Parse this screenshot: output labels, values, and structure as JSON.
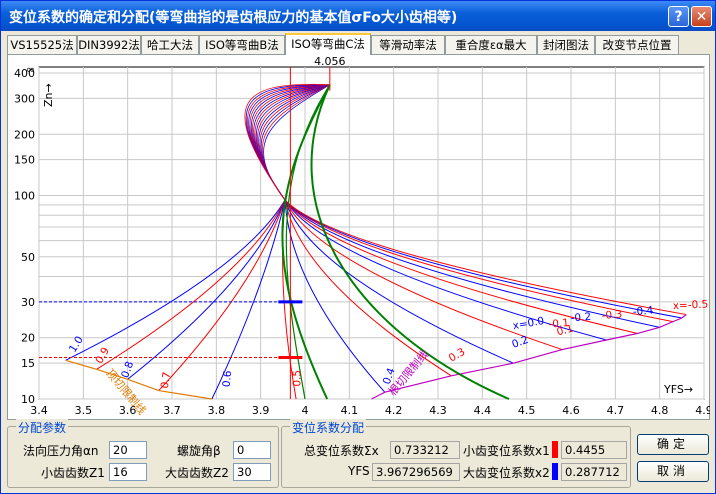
{
  "window": {
    "title": "变位系数的确定和分配(等弯曲指的是齿根应力的基本值σFo大小齿相等)",
    "help_label": "?",
    "close_label": "✕"
  },
  "tabs": [
    "VS15525法",
    "DIN3992法",
    "哈工大法",
    "ISO等弯曲B法",
    "ISO等弯曲C法",
    "等滑动率法",
    "重合度εα最大",
    "封闭图法",
    "改变节点位置"
  ],
  "active_tab": 4,
  "chart_data": {
    "type": "line",
    "xlabel": "YFS→",
    "ylabel": "Zn→",
    "xlim": [
      3.4,
      4.9
    ],
    "y_scale": "log",
    "ylim": [
      10,
      400
    ],
    "x_ticks": [
      "3.4",
      "3.5",
      "3.6",
      "3.7",
      "3.8",
      "3.9",
      "4",
      "4.1",
      "4.2",
      "4.3",
      "4.4",
      "4.5",
      "4.6",
      "4.7",
      "4.8",
      "4.9"
    ],
    "y_ticks": [
      "10",
      "15",
      "20",
      "30",
      "50",
      "100",
      "150",
      "200",
      "300",
      "400",
      "∞"
    ],
    "marker_value": "4.056",
    "marker_x": 4.056,
    "vertical_line_x": 3.967,
    "horizontal_lines": [
      {
        "y": 30,
        "color": "#0000ff",
        "x_end": 3.967
      },
      {
        "y": 16,
        "color": "#ff0000",
        "x_end": 3.967
      }
    ],
    "curve_labels": [
      {
        "text": "1.0",
        "color": "#0000ff"
      },
      {
        "text": "0.9",
        "color": "#ff0000"
      },
      {
        "text": "0.8",
        "color": "#0000ff"
      },
      {
        "text": "0.7",
        "color": "#ff0000"
      },
      {
        "text": "0.6",
        "color": "#0000ff"
      },
      {
        "text": "0.5",
        "color": "#ff0000"
      },
      {
        "text": "0.4",
        "color": "#0000ff"
      },
      {
        "text": "0.3",
        "color": "#ff0000"
      },
      {
        "text": "0.2",
        "color": "#0000ff"
      },
      {
        "text": "0.1",
        "color": "#ff0000"
      },
      {
        "text": "x=0.0",
        "color": "#0000ff"
      },
      {
        "text": "-0.1",
        "color": "#ff0000"
      },
      {
        "text": "-0.2",
        "color": "#0000ff"
      },
      {
        "text": "-0.3",
        "color": "#ff0000"
      },
      {
        "text": "-0.4",
        "color": "#0000ff"
      },
      {
        "text": "x=-0.5",
        "color": "#ff0000"
      }
    ],
    "boundary_labels": [
      {
        "text": "顶切限制线",
        "color": "#e07b00"
      },
      {
        "text": "根切限制线",
        "color": "#c000c0"
      }
    ],
    "series_colors": {
      "blue": "#0000ff",
      "red": "#ff0000",
      "green": "#008000",
      "grid": "#c8c8c8"
    }
  },
  "params": {
    "title": "分配参数",
    "alpha_label": "法向压力角αn",
    "alpha_value": "20",
    "beta_label": "螺旋角β",
    "beta_value": "0",
    "z1_label": "小齿齿数Z1",
    "z1_value": "16",
    "z2_label": "大齿齿数Z2",
    "z2_value": "30"
  },
  "dist": {
    "title": "变位系数分配",
    "total_label": "总变位系数Σx",
    "total_value": "0.733212",
    "x1_label": "小齿变位系数x1",
    "x1_value": "0.4455",
    "yfs_label": "YFS",
    "yfs_value": "3.967296569",
    "x2_label": "大齿变位系数x2",
    "x2_value": "0.287712",
    "x1_color": "#ff0000",
    "x2_color": "#0000ff"
  },
  "buttons": {
    "ok": "确定",
    "cancel": "取消"
  }
}
